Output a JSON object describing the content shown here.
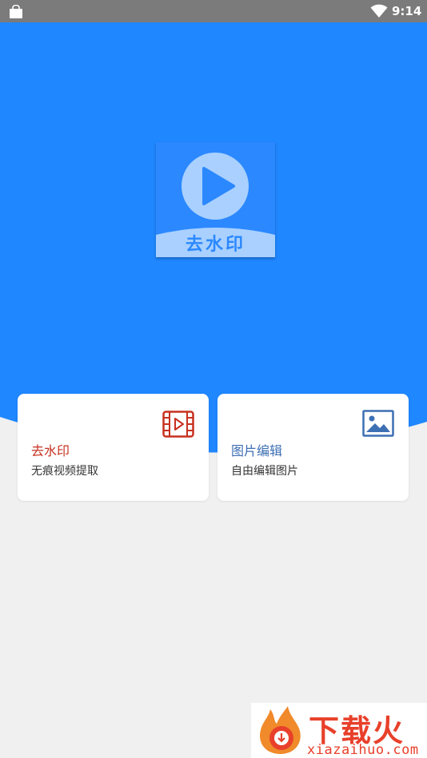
{
  "status_bar": {
    "time": "9:14",
    "icons": [
      "shopping-bag-icon",
      "wifi-icon"
    ]
  },
  "logo": {
    "text": "去水印",
    "icon": "play-icon"
  },
  "cards": [
    {
      "title": "去水印",
      "subtitle": "无痕视频提取",
      "icon": "film-icon",
      "title_color": "#c7301f"
    },
    {
      "title": "图片编辑",
      "subtitle": "自由编辑图片",
      "icon": "image-icon",
      "title_color": "#3d6fb3"
    }
  ],
  "watermark": {
    "main": "下载火",
    "sub": "xiazaihuo.com"
  },
  "colors": {
    "primary_blue": "#1f87ff",
    "status_bar": "#7b7b7b",
    "background": "#f0f0f0"
  }
}
